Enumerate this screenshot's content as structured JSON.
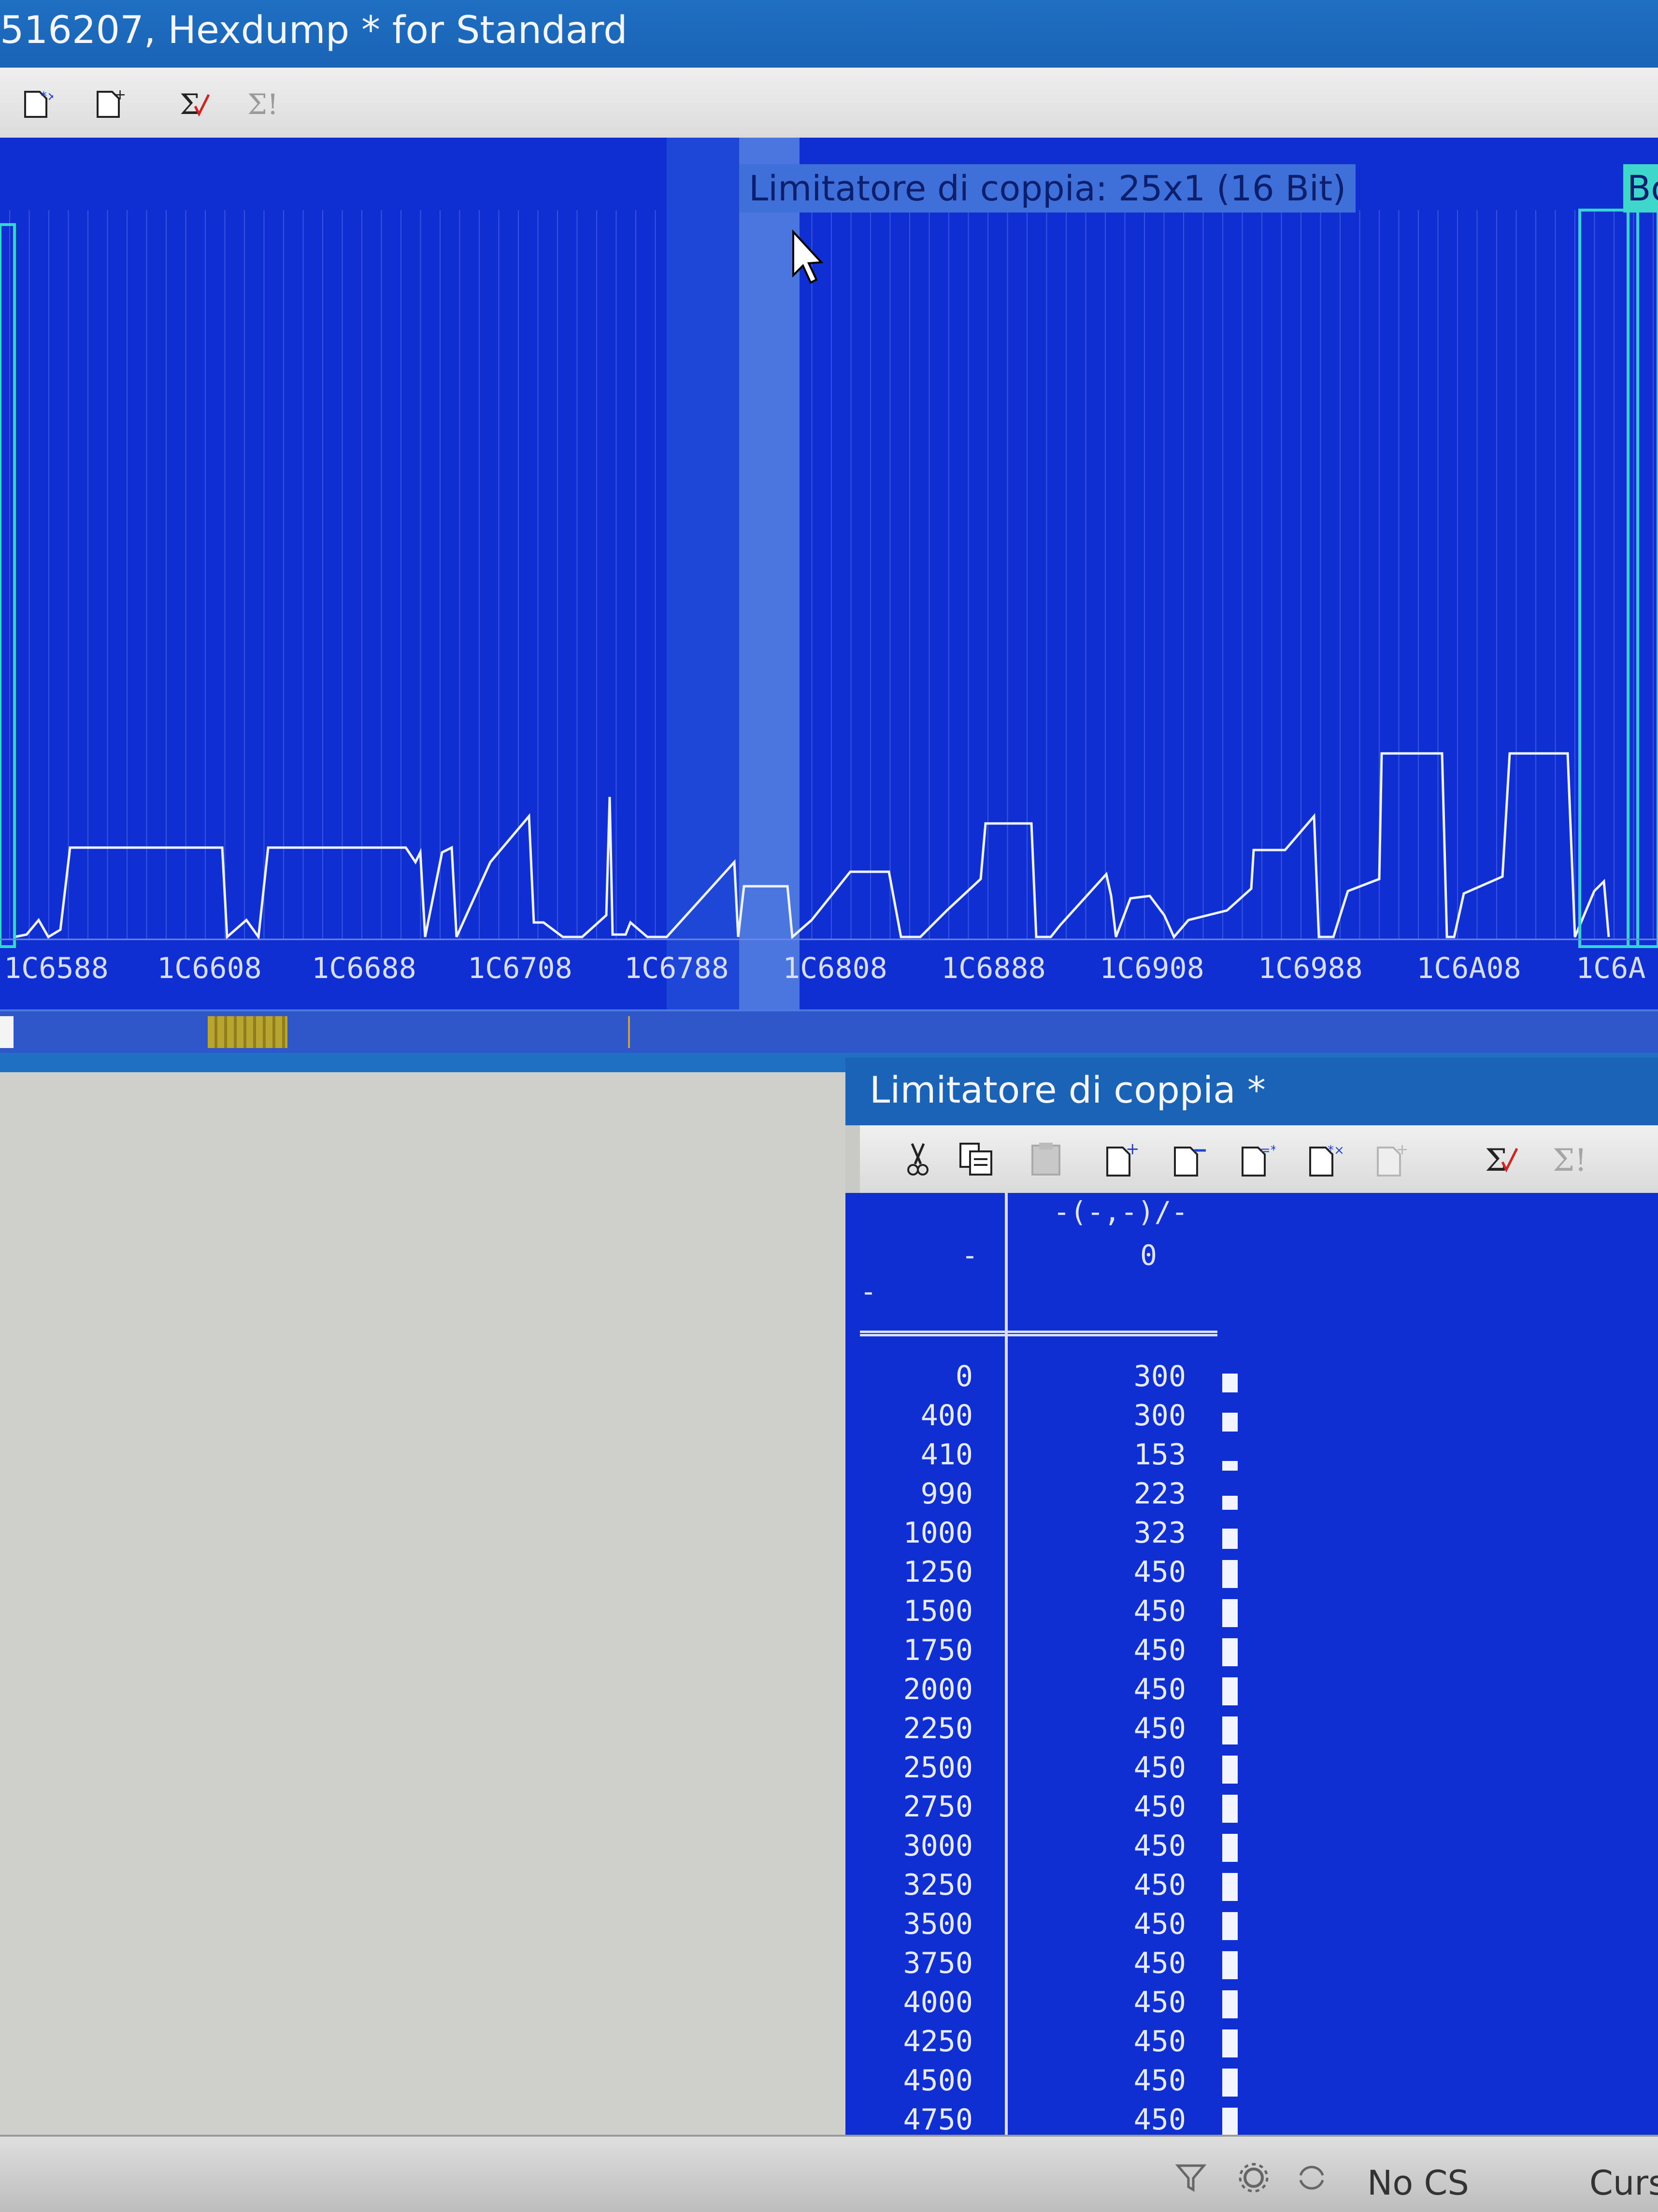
{
  "window": {
    "title": "516207, Hexdump * for Standard"
  },
  "toolbar": {
    "icons": [
      "doc-star-icon",
      "doc-plus-icon",
      "sigma-check-icon",
      "sigma-bang-icon"
    ]
  },
  "graph": {
    "tooltip": "Limitatore di coppia: 25x1 (16 Bit)",
    "right_tooltip": "Bo",
    "addresses": [
      "1C6588",
      "1C6608",
      "1C6688",
      "1C6708",
      "1C6788",
      "1C6808",
      "1C6888",
      "1C6908",
      "1C6988",
      "1C6A08",
      "1C6A"
    ]
  },
  "map_window": {
    "title": "Limitatore di coppia *",
    "toolbar_icons": [
      "cut-icon",
      "copy-icon",
      "paste-icon",
      "doc-plus-icon",
      "doc-minus-icon",
      "doc-equal-icon",
      "doc-star-icon",
      "doc-arrow-icon",
      "sigma-check-icon",
      "sigma-bang-icon"
    ],
    "col_header_top": "-(-,-)/-",
    "col_header_value": "0",
    "row_header": "-",
    "row_header2": "-",
    "rows": [
      {
        "key": "0",
        "value": "300",
        "level": 300
      },
      {
        "key": "400",
        "value": "300",
        "level": 300
      },
      {
        "key": "410",
        "value": "153",
        "level": 153
      },
      {
        "key": "990",
        "value": "223",
        "level": 223
      },
      {
        "key": "1000",
        "value": "323",
        "level": 323
      },
      {
        "key": "1250",
        "value": "450",
        "level": 450
      },
      {
        "key": "1500",
        "value": "450",
        "level": 450
      },
      {
        "key": "1750",
        "value": "450",
        "level": 450
      },
      {
        "key": "2000",
        "value": "450",
        "level": 450
      },
      {
        "key": "2250",
        "value": "450",
        "level": 450
      },
      {
        "key": "2500",
        "value": "450",
        "level": 450
      },
      {
        "key": "2750",
        "value": "450",
        "level": 450
      },
      {
        "key": "3000",
        "value": "450",
        "level": 450
      },
      {
        "key": "3250",
        "value": "450",
        "level": 450
      },
      {
        "key": "3500",
        "value": "450",
        "level": 450
      },
      {
        "key": "3750",
        "value": "450",
        "level": 450
      },
      {
        "key": "4000",
        "value": "450",
        "level": 450
      },
      {
        "key": "4250",
        "value": "450",
        "level": 450
      },
      {
        "key": "4500",
        "value": "450",
        "level": 450
      },
      {
        "key": "4750",
        "value": "450",
        "level": 450
      }
    ]
  },
  "statusbar": {
    "cs": "No CS",
    "cursor": "Curs"
  }
}
